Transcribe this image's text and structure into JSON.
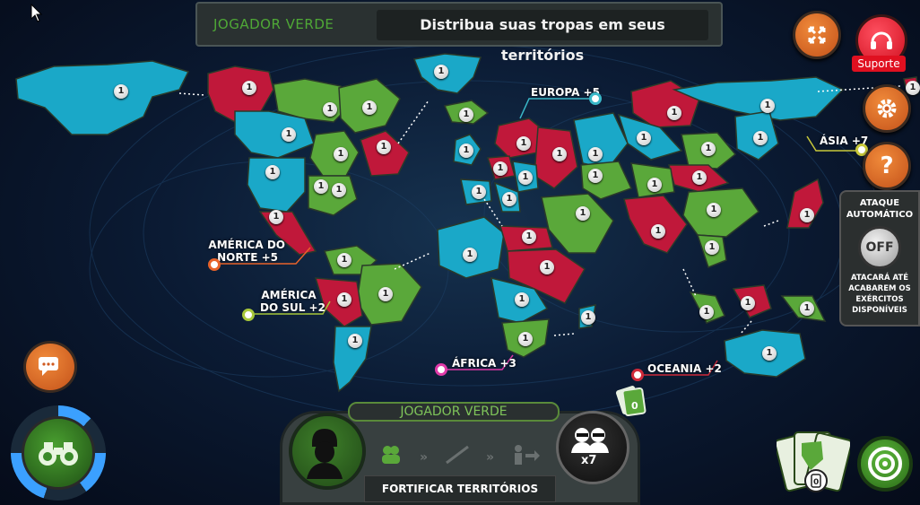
{
  "header": {
    "player_label": "JOGADOR VERDE",
    "instruction": "Distribua suas tropas em seus territórios"
  },
  "buttons": {
    "support_label": "Suporte",
    "fullscreen_icon": "expand-arrows-icon",
    "settings_icon": "gear-icon",
    "help_label": "?"
  },
  "auto_attack": {
    "title": "ATAQUE AUTOMÁTICO",
    "toggle_label": "OFF",
    "description": "ATACARÁ ATÉ ACABAREM OS EXÉRCITOS DISPONÍVEIS"
  },
  "continents": [
    {
      "label": "AMÉRICA DO NORTE +5",
      "line1": "AMÉRICA DO",
      "line2": "NORTE +5",
      "color": "#e8632a"
    },
    {
      "label": "AMÉRICA DO SUL +2",
      "line1": "AMÉRICA",
      "line2": "DO SUL +2",
      "color": "#a8c83a"
    },
    {
      "label": "EUROPA +5",
      "line1": "EUROPA +5",
      "line2": "",
      "color": "#3ab8c8"
    },
    {
      "label": "ÁSIA +7",
      "line1": "ÁSIA +7",
      "line2": "",
      "color": "#c8c83a"
    },
    {
      "label": "ÁFRICA +3",
      "line1": "ÁFRICA +3",
      "line2": "",
      "color": "#e03aa8"
    },
    {
      "label": "OCEANIA +2",
      "line1": "OCEANIA +2",
      "line2": "",
      "color": "#d02a3a"
    }
  ],
  "territory_troops": "1",
  "colors": {
    "green": "#5aa83a",
    "red": "#c0183a",
    "blue": "#1aa8c8",
    "accent_orange": "#e06a2a"
  },
  "hud": {
    "player_name": "JOGADOR VERDE",
    "phase_label": "FORTIFICAR TERRITÓRIOS",
    "troops_available": "x7",
    "cards_count": "0",
    "mini_cards_count": "0"
  }
}
